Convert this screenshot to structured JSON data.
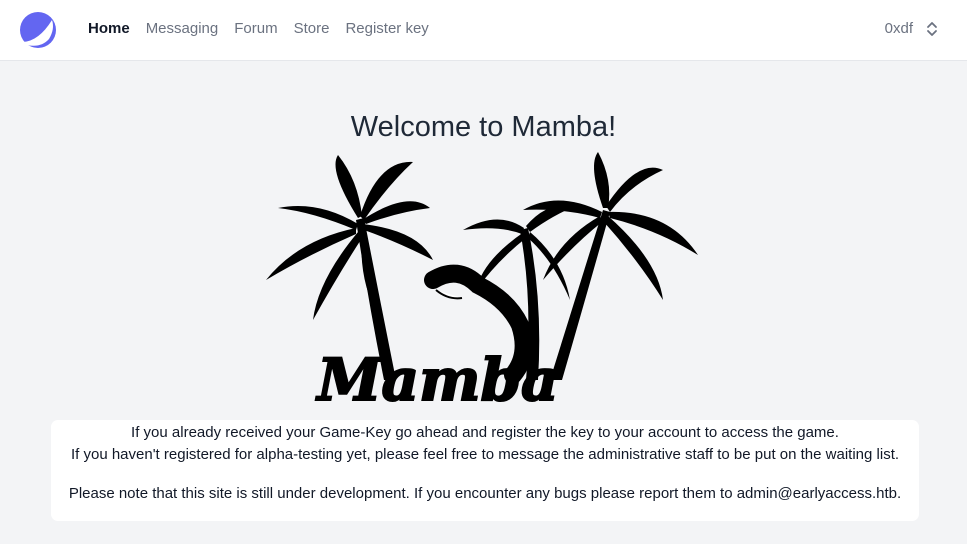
{
  "header": {
    "logo_icon": "crescent-logo-icon",
    "nav": [
      {
        "label": "Home",
        "active": true
      },
      {
        "label": "Messaging",
        "active": false
      },
      {
        "label": "Forum",
        "active": false
      },
      {
        "label": "Store",
        "active": false
      },
      {
        "label": "Register key",
        "active": false
      }
    ],
    "user": {
      "name": "0xdf",
      "icon": "chevron-up-down-icon"
    }
  },
  "main": {
    "title": "Welcome to Mamba!",
    "hero_wordmark": "Mamba",
    "info": {
      "line1": "If you already received your Game-Key go ahead and register the key to your account to access the game.",
      "line2": "If you haven't registered for alpha-testing yet, please feel free to message the administrative staff to be put on the waiting list.",
      "note": "Please note that this site is still under development. If you encounter any bugs please report them to admin@earlyaccess.htb."
    }
  },
  "colors": {
    "accent": "#6366f1",
    "background": "#f3f4f6",
    "card": "#ffffff"
  }
}
